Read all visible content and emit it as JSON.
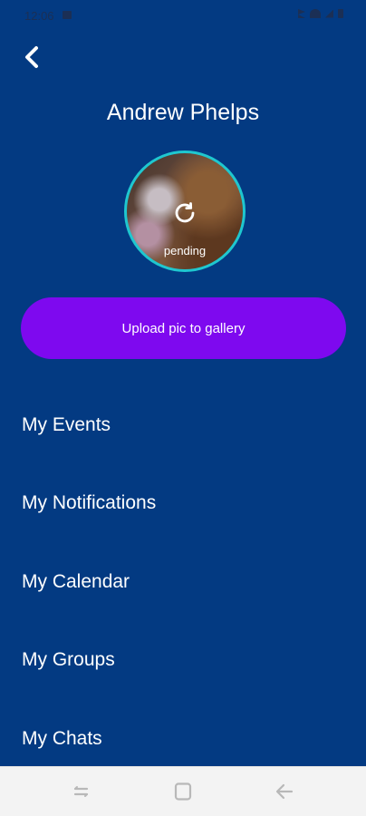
{
  "status_bar": {
    "time": "12:06"
  },
  "header": {
    "back_icon": "chevron-left-icon"
  },
  "profile": {
    "name": "Andrew Phelps",
    "avatar_status": "pending"
  },
  "actions": {
    "upload_label": "Upload pic to gallery"
  },
  "menu": {
    "items": [
      {
        "label": "My Events"
      },
      {
        "label": "My Notifications"
      },
      {
        "label": "My Calendar"
      },
      {
        "label": "My Groups"
      },
      {
        "label": "My Chats"
      }
    ]
  },
  "colors": {
    "background": "#033a82",
    "accent": "#7e09ef",
    "avatar_ring": "#1fc7cf",
    "nav_bar": "#f3f3f3"
  },
  "icons": {
    "refresh": "refresh-icon",
    "recents": "recents-icon",
    "home": "home-icon",
    "nav_back": "back-arrow-icon"
  }
}
